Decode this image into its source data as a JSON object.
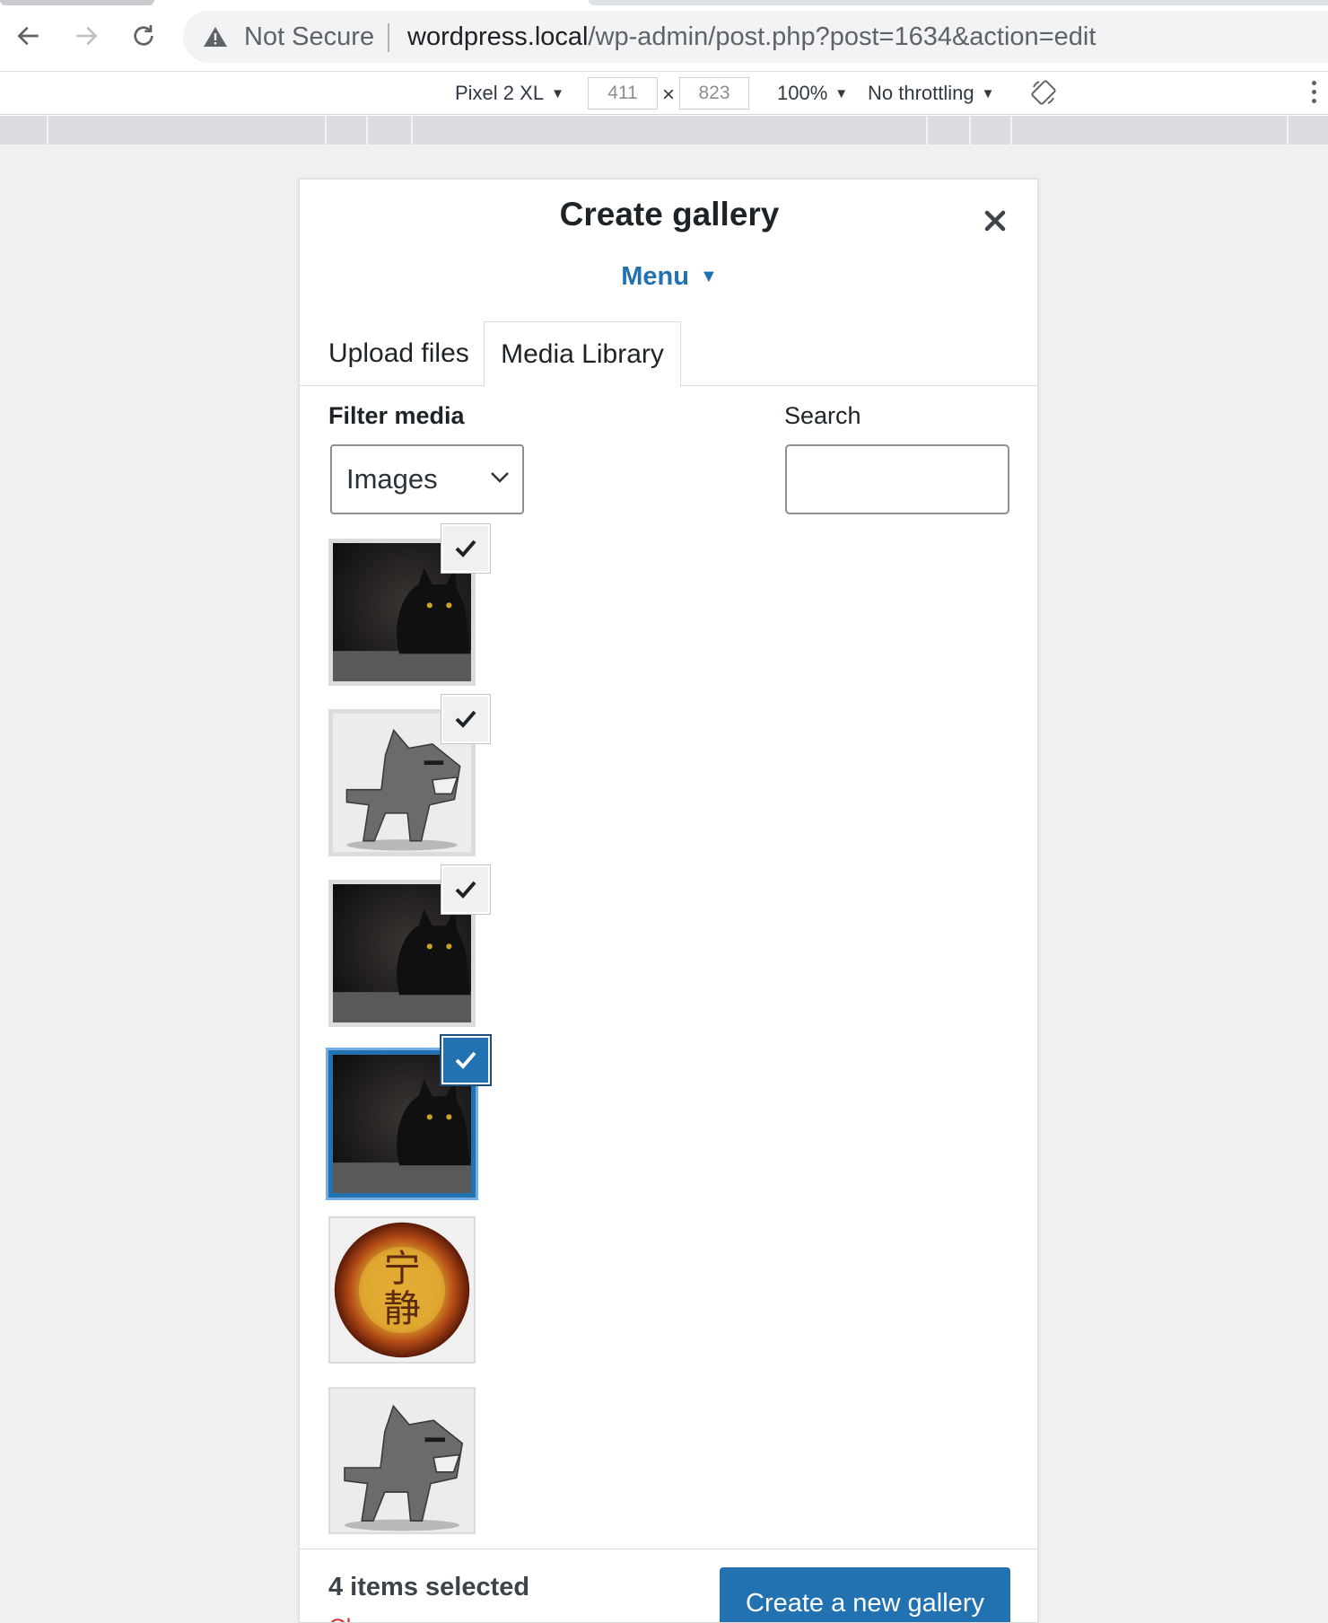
{
  "browser": {
    "warning_text": "Not Secure",
    "url_host": "wordpress.local",
    "url_path": "/wp-admin/post.php?post=1634&action=edit"
  },
  "devtools": {
    "device": "Pixel 2 XL",
    "width": "411",
    "height": "823",
    "times": "×",
    "zoom": "100%",
    "throttling": "No throttling",
    "caret": "▼"
  },
  "modal": {
    "title": "Create gallery",
    "menu_label": "Menu",
    "menu_caret": "▼",
    "tabs": [
      {
        "label": "Upload files",
        "active": false
      },
      {
        "label": "Media Library",
        "active": true
      }
    ],
    "filter_label": "Filter media",
    "filter_value": "Images",
    "search_label": "Search",
    "search_value": ""
  },
  "attachments": [
    {
      "image": "black-cat-photo",
      "selected": true,
      "details": false
    },
    {
      "image": "grey-cartoon-cat",
      "selected": true,
      "details": false
    },
    {
      "image": "black-cat-photo",
      "selected": true,
      "details": false
    },
    {
      "image": "black-cat-photo",
      "selected": true,
      "details": true
    },
    {
      "image": "orange-seal-kanji",
      "selected": false,
      "details": false,
      "kanji": [
        "宁",
        "静"
      ]
    },
    {
      "image": "grey-cartoon-cat",
      "selected": false,
      "details": false
    }
  ],
  "toolbar": {
    "selection_count": "4 items selected",
    "clear_label": "Clear",
    "primary_button": "Create a new gallery"
  },
  "colors": {
    "accent": "#2271b1",
    "danger": "#d63638",
    "text": "#1d2327"
  }
}
